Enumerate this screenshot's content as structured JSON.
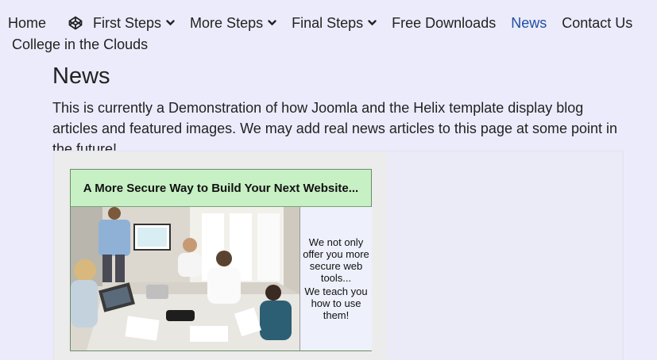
{
  "nav": {
    "items": [
      {
        "label": "Home"
      },
      {
        "label": "First Steps"
      },
      {
        "label": "More Steps"
      },
      {
        "label": "Final Steps"
      },
      {
        "label": "Free Downloads"
      },
      {
        "label": "News"
      },
      {
        "label": "Contact Us"
      }
    ],
    "second_row": "College in the Clouds",
    "active_color": "#1f4fa0"
  },
  "page": {
    "title": "News",
    "intro": "This is currently a Demonstration of how Joomla and the Helix template display blog articles and featured images. We may add real news articles to this page at some point in the future!"
  },
  "article": {
    "image_heading": "A More Secure Way to Build Your Next Website...",
    "image_side_1": "We not only offer you more secure web tools...",
    "image_side_2": "We teach you how to use them!",
    "header_color": "#c7f0c4"
  }
}
